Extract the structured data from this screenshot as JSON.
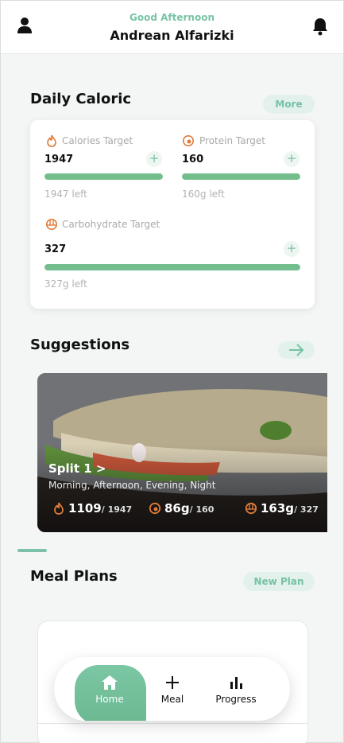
{
  "header": {
    "greeting": "Good Afternoon",
    "user_name": "Andrean Alfarizki",
    "profile_icon": "person-icon",
    "notification_icon": "bell-icon"
  },
  "daily_caloric": {
    "title": "Daily Caloric",
    "more_label": "More",
    "targets": [
      {
        "label": "Calories Target",
        "value": "1947",
        "left": "1947 left",
        "icon": "flame-icon",
        "progress": 1.0
      },
      {
        "label": "Protein Target",
        "value": "160",
        "left": "160g left",
        "icon": "protein-icon",
        "progress": 1.0
      },
      {
        "label": "Carbohydrate Target",
        "value": "327",
        "left": "327g left",
        "icon": "carb-icon",
        "progress": 1.0
      }
    ],
    "add_label": "+"
  },
  "suggestions": {
    "title": "Suggestions",
    "arrow_icon": "arrow-right-icon",
    "card": {
      "title": "Split 1 >",
      "subtitle": "Morning, Afternoon, Evening, Night",
      "calories": "1109",
      "calories_total": "/ 1947",
      "protein": "86g",
      "protein_total": "/ 160",
      "carbs": "163g",
      "carbs_total": "/ 327"
    }
  },
  "meal_plans": {
    "title": "Meal Plans",
    "new_plan_label": "New Plan"
  },
  "nav": {
    "items": [
      {
        "label": "Home",
        "icon": "home-icon",
        "active": true
      },
      {
        "label": "Meal",
        "icon": "plus-icon",
        "active": false
      },
      {
        "label": "Progress",
        "icon": "bar-chart-icon",
        "active": false
      }
    ]
  },
  "colors": {
    "accent": "#79c4a6",
    "bar_fill": "#74be8e",
    "icon_orange": "#e07b39"
  }
}
